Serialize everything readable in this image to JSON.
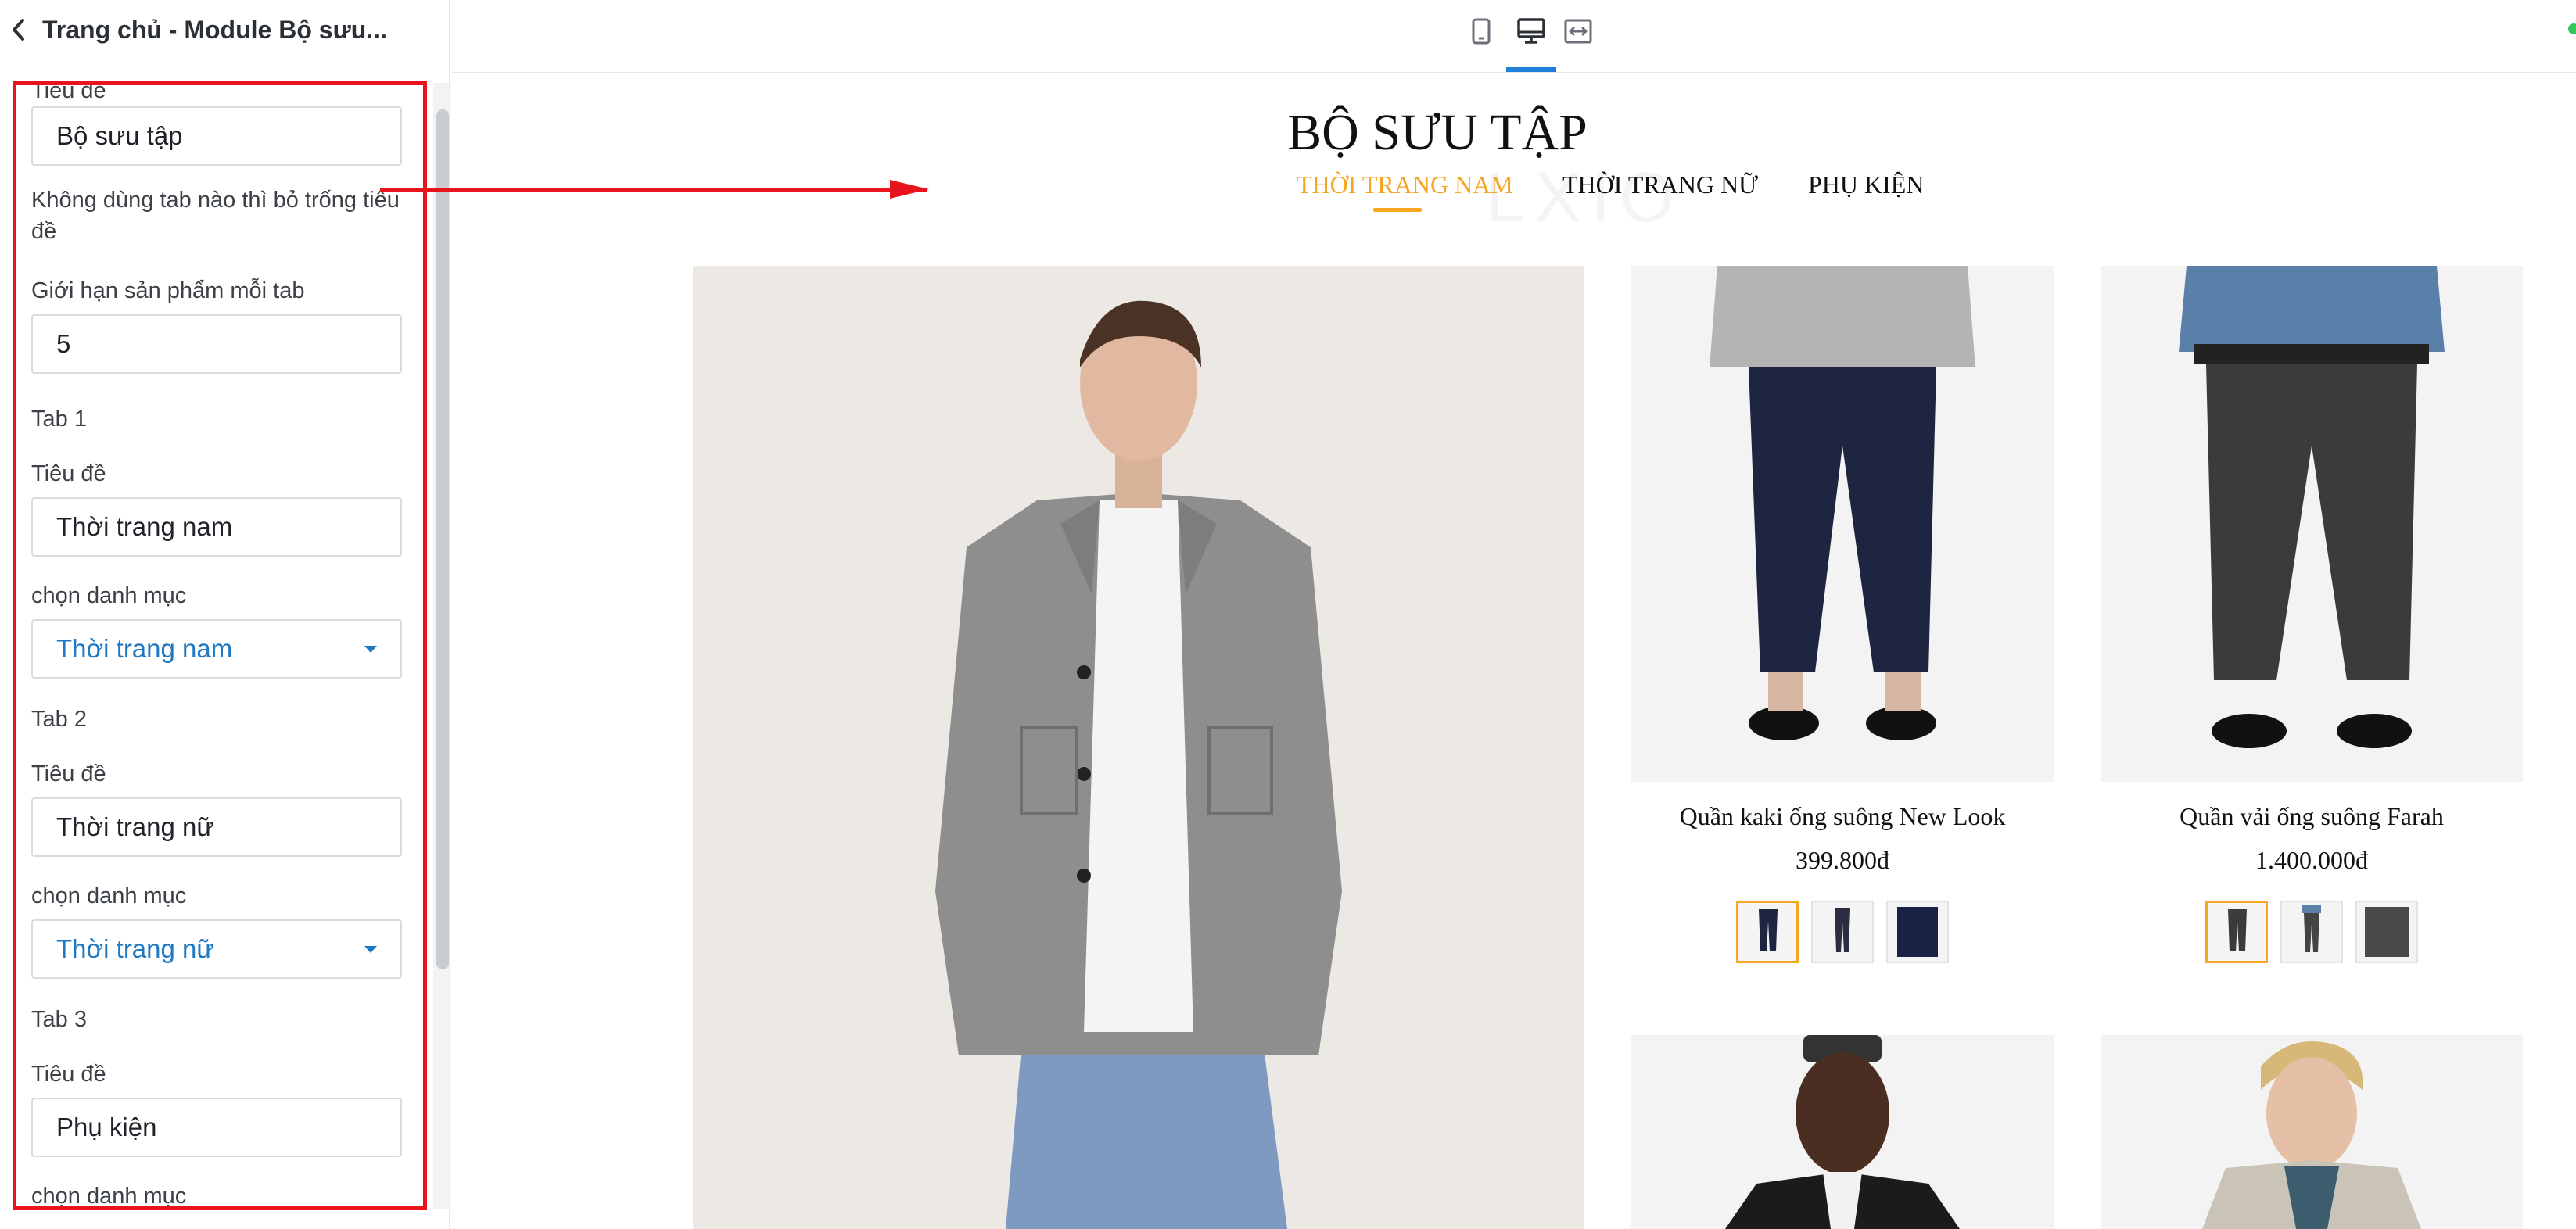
{
  "sidebar": {
    "title": "Trang chủ - Module Bộ sưu...",
    "collection_title_label": "Tiêu đề",
    "collection_title_value": "Bộ sưu tập",
    "note": "Không dùng tab nào thì bỏ trống tiêu đề",
    "limit_label": "Giới hạn sản phẩm mỗi tab",
    "limit_value": "5",
    "tabs": [
      {
        "heading": "Tab 1",
        "title_label": "Tiêu đề",
        "title_value": "Thời trang nam",
        "category_label": "chọn danh mục",
        "category_value": "Thời trang nam"
      },
      {
        "heading": "Tab 2",
        "title_label": "Tiêu đề",
        "title_value": "Thời trang nữ",
        "category_label": "chọn danh mục",
        "category_value": "Thời trang nữ"
      },
      {
        "heading": "Tab 3",
        "title_label": "Tiêu đề",
        "title_value": "Phụ kiện",
        "category_label": "chọn danh mục"
      }
    ]
  },
  "toolbar": {
    "devices": [
      "mobile-icon",
      "desktop-icon",
      "fullwidth-icon"
    ],
    "active_device": "desktop-icon",
    "accent_color": "#1f7fd8"
  },
  "preview": {
    "section_title": "BỘ SƯU TẬP",
    "tabs": [
      "THỜI TRANG NAM",
      "THỜI TRANG NỮ",
      "PHỤ KIỆN"
    ],
    "active_tab": "THỜI TRANG NAM",
    "accent_color": "#f5a623",
    "products": [
      {
        "name": "Quần kaki ống suông New Look",
        "price": "399.800đ"
      },
      {
        "name": "Quần vải ống suông Farah",
        "price": "1.400.000đ"
      }
    ]
  },
  "annotation_color": "#e8141d"
}
